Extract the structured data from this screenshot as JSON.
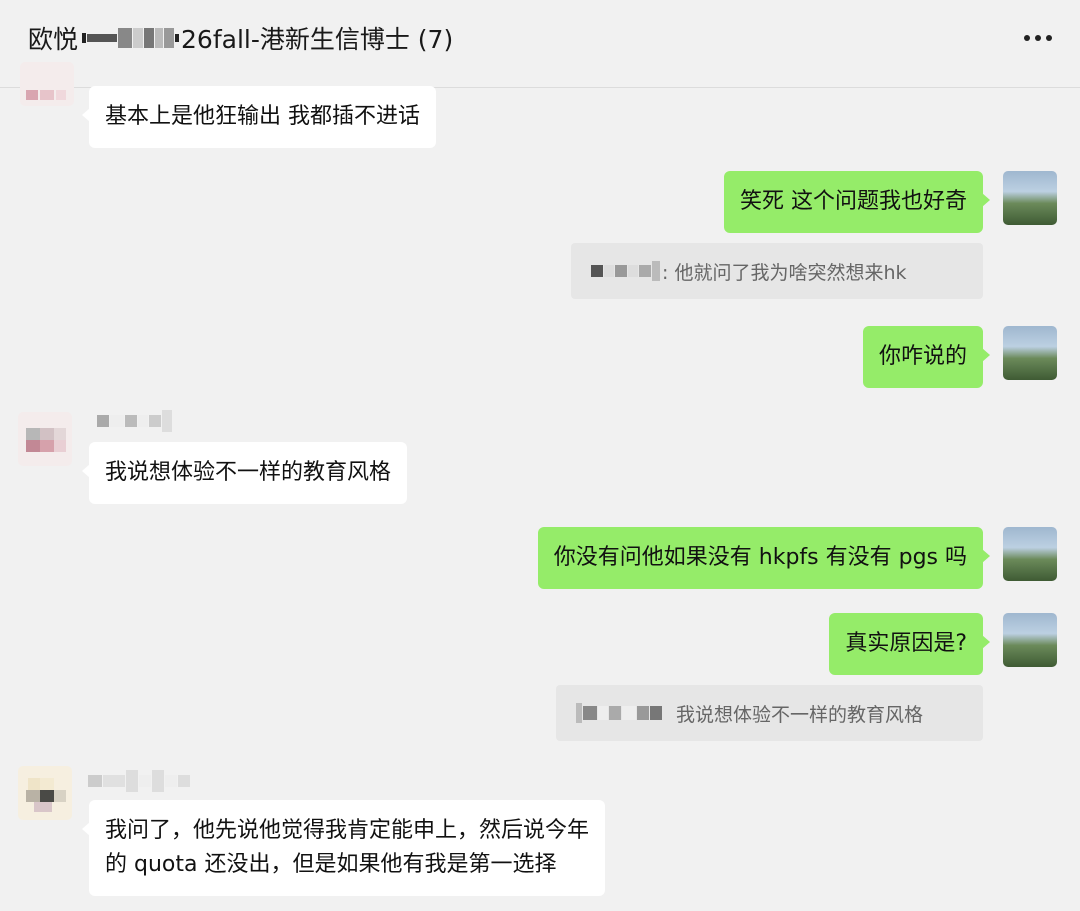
{
  "header": {
    "title_prefix": "欧悦",
    "title_suffix": "26fall-港新生信博士 (7)",
    "more_icon": "more-horizontal-icon"
  },
  "messages": [
    {
      "side": "in",
      "text": "基本上是他狂输出 我都插不进话"
    },
    {
      "side": "out",
      "text": "笑死 这个问题我也好奇"
    },
    {
      "quote": ": 他就问了我为啥突然想来hk"
    },
    {
      "side": "out",
      "text": "你咋说的"
    },
    {
      "side": "in",
      "text": "我说想体验不一样的教育风格"
    },
    {
      "side": "out",
      "text": "你没有问他如果没有 hkpfs 有没有 pgs 吗"
    },
    {
      "side": "out",
      "text": "真实原因是?"
    },
    {
      "quote": "我说想体验不一样的教育风格"
    },
    {
      "side": "in",
      "line1": "我问了，他先说他觉得我肯定能申上，然后说今年",
      "line2": "的 quota 还没出，但是如果他有我是第一选择"
    }
  ],
  "colors": {
    "background": "#f1f1f1",
    "outgoing_bubble": "#95ec69",
    "incoming_bubble": "#ffffff",
    "quote_bg": "#e6e6e6"
  }
}
